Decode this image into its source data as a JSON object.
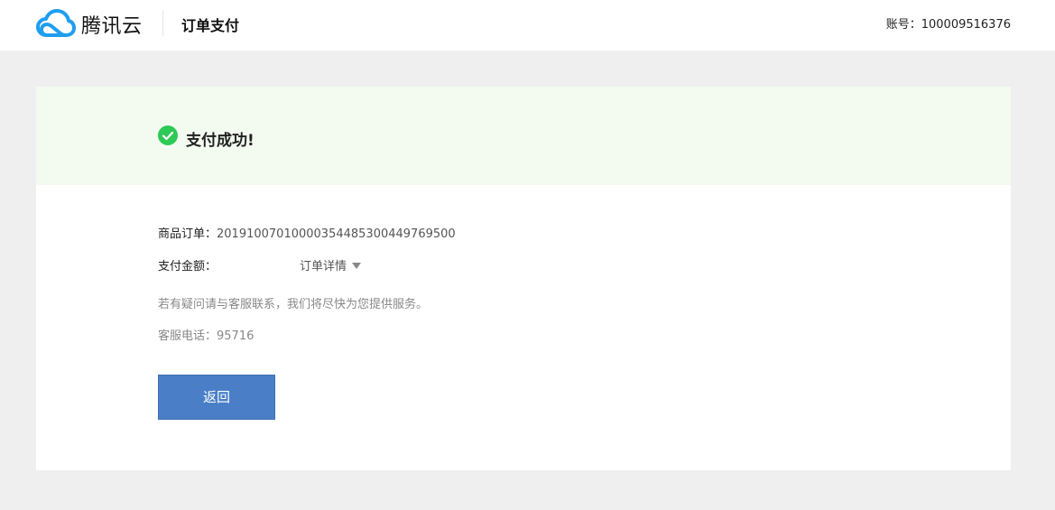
{
  "header": {
    "brand": "腾讯云",
    "page_title": "订单支付",
    "account_label": "账号：",
    "account_number": "100009516376"
  },
  "result": {
    "status": "支付成功!"
  },
  "order": {
    "order_label": "商品订单：",
    "order_number": "20191007010000354485300449769500",
    "amount_label": "支付金额：",
    "details_link": "订单详情"
  },
  "support": {
    "notice": "若有疑问请与客服联系，我们将尽快为您提供服务。",
    "phone_label": "客服电话：",
    "phone_number": "95716"
  },
  "actions": {
    "back_label": "返回"
  },
  "colors": {
    "accent": "#4a7fc8",
    "success": "#2ec956",
    "success_band": "#f3fbf1",
    "logo_blue": "#1f9ef0"
  },
  "icons": {
    "logo": "tencent-cloud-logo-icon",
    "success": "check-circle-icon",
    "details": "caret-down-icon"
  }
}
